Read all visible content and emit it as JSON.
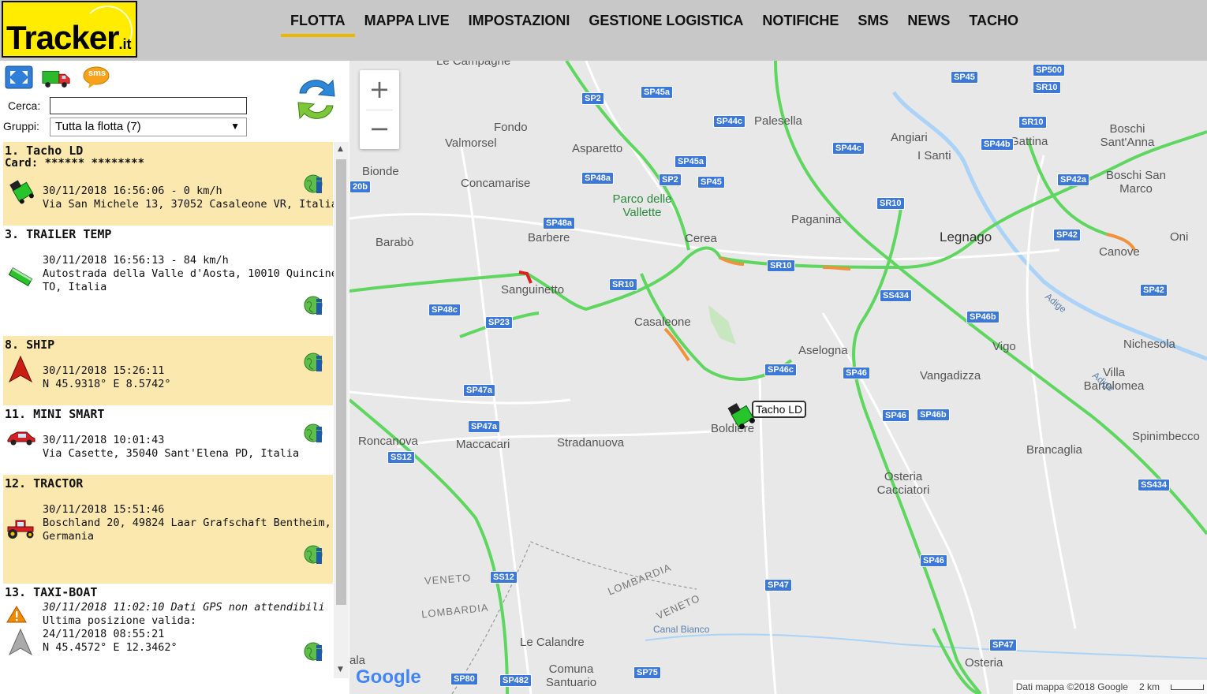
{
  "logo": {
    "brand": "Tracker",
    "tld": ".it"
  },
  "nav": {
    "items": [
      {
        "label": "FLOTTA",
        "active": true
      },
      {
        "label": "MAPPA LIVE",
        "active": false
      },
      {
        "label": "IMPOSTAZIONI",
        "active": false
      },
      {
        "label": "GESTIONE LOGISTICA",
        "active": false
      },
      {
        "label": "NOTIFICHE",
        "active": false
      },
      {
        "label": "SMS",
        "active": false
      },
      {
        "label": "NEWS",
        "active": false
      },
      {
        "label": "TACHO",
        "active": false
      }
    ],
    "active_color": "#e9b800"
  },
  "toolbar": {
    "sms_badge": "sms"
  },
  "search": {
    "label": "Cerca:",
    "value": ""
  },
  "groups": {
    "label": "Gruppi:",
    "selected": "Tutta la flotta (7)"
  },
  "vehicles": [
    {
      "title": "1. Tacho LD",
      "card": "Card: ****** ********",
      "lines": [
        "30/11/2018 16:56:06 - 0 km/h",
        "Via San Michele 13, 37052 Casaleone VR, Italia"
      ]
    },
    {
      "title": "3. TRAILER TEMP",
      "lines": [
        "30/11/2018 16:56:13 - 84 km/h",
        "Autostrada della Valle d'Aosta, 10010 Quincinetto",
        "TO, Italia"
      ]
    },
    {
      "title": "8. SHIP",
      "lines": [
        "30/11/2018 15:26:11",
        "N 45.9318° E 8.5742°"
      ]
    },
    {
      "title": "11. MINI SMART",
      "lines": [
        "30/11/2018 10:01:43",
        "Via Casette, 35040 Sant'Elena PD, Italia"
      ]
    },
    {
      "title": "12. TRACTOR",
      "lines": [
        "30/11/2018 15:51:46",
        "Boschland 20, 49824 Laar Grafschaft Bentheim,",
        "Germania"
      ]
    },
    {
      "title": "13. TAXI-BOAT",
      "lines": [
        "30/11/2018 11:02:10 Dati GPS non attendibili",
        "Ultima posizione valida:",
        "24/11/2018 08:55:21",
        "N 45.4572° E 12.3462°"
      ]
    }
  ],
  "map": {
    "places": [
      {
        "name": "Le Campagne",
        "kind": "normal"
      },
      {
        "name": "Fondo",
        "kind": "normal"
      },
      {
        "name": "Valmorsel",
        "kind": "normal"
      },
      {
        "name": "Asparetto",
        "kind": "normal"
      },
      {
        "name": "Palesella",
        "kind": "normal"
      },
      {
        "name": "Angiari",
        "kind": "normal"
      },
      {
        "name": "I Santi",
        "kind": "normal"
      },
      {
        "name": "Gattina",
        "kind": "normal"
      },
      {
        "name": "Boschi Sant'Anna",
        "kind": "normal"
      },
      {
        "name": "Bionde",
        "kind": "normal"
      },
      {
        "name": "Concamarise",
        "kind": "normal"
      },
      {
        "name": "Parco delle Vallette",
        "kind": "park"
      },
      {
        "name": "Boschi San Marco",
        "kind": "normal"
      },
      {
        "name": "Paganina",
        "kind": "normal"
      },
      {
        "name": "Barabò",
        "kind": "normal"
      },
      {
        "name": "Barbere",
        "kind": "normal"
      },
      {
        "name": "Cerea",
        "kind": "normal"
      },
      {
        "name": "Legnago",
        "kind": "big"
      },
      {
        "name": "Oni",
        "kind": "normal"
      },
      {
        "name": "Canove",
        "kind": "normal"
      },
      {
        "name": "Sanguinetto",
        "kind": "normal"
      },
      {
        "name": "Casaleone",
        "kind": "normal"
      },
      {
        "name": "Aselogna",
        "kind": "normal"
      },
      {
        "name": "Vigo",
        "kind": "normal"
      },
      {
        "name": "Nichesola",
        "kind": "normal"
      },
      {
        "name": "Vangadizza",
        "kind": "normal"
      },
      {
        "name": "Villa Bartolomea",
        "kind": "normal"
      },
      {
        "name": "Roncanova",
        "kind": "normal"
      },
      {
        "name": "Maccacari",
        "kind": "normal"
      },
      {
        "name": "Stradanuova",
        "kind": "normal"
      },
      {
        "name": "Boldiere",
        "kind": "normal"
      },
      {
        "name": "Brancaglia",
        "kind": "normal"
      },
      {
        "name": "Spinimbecco",
        "kind": "normal"
      },
      {
        "name": "Osteria Cacciatori",
        "kind": "normal"
      },
      {
        "name": "VENETO",
        "kind": "region"
      },
      {
        "name": "LOMBARDIA",
        "kind": "region"
      },
      {
        "name": "LOMBARDIA",
        "kind": "region"
      },
      {
        "name": "VENETO",
        "kind": "region"
      },
      {
        "name": "Canal Bianco",
        "kind": "canal"
      },
      {
        "name": "Le Calandre",
        "kind": "normal"
      },
      {
        "name": "Comuna Santuario",
        "kind": "normal"
      },
      {
        "name": "Osteria",
        "kind": "normal"
      },
      {
        "name": "Adige",
        "kind": "canal"
      },
      {
        "name": "Adige",
        "kind": "canal"
      },
      {
        "name": "ala",
        "kind": "normal"
      }
    ],
    "shields": [
      "SP500",
      "SR10",
      "SP2",
      "SP45a",
      "SP45",
      "SP44c",
      "SP44c",
      "SR10",
      "SP44b",
      "SP45a",
      "SP48a",
      "SP2",
      "SP45",
      "SP42a",
      "SR10",
      "SR10",
      "SP42",
      "SP48a",
      "SR10",
      "SR10",
      "SP48c",
      "SS434",
      "SP42",
      "SP23",
      "SP46b",
      "SP46c",
      "SP46",
      "SP47a",
      "SP46",
      "SP46b",
      "SP47a",
      "SS12",
      "SS434",
      "SS12",
      "SP47",
      "SP46",
      "SP47",
      "SP80",
      "SP482",
      "SP75",
      "20b"
    ],
    "truck_label": "Tacho LD",
    "zoom_in": "+",
    "zoom_out": "−",
    "google": "Google",
    "attribution": "Dati mappa ©2018 Google",
    "scale": "2 km",
    "road_green": "#5fd65f",
    "road_orange": "#f0913c"
  }
}
